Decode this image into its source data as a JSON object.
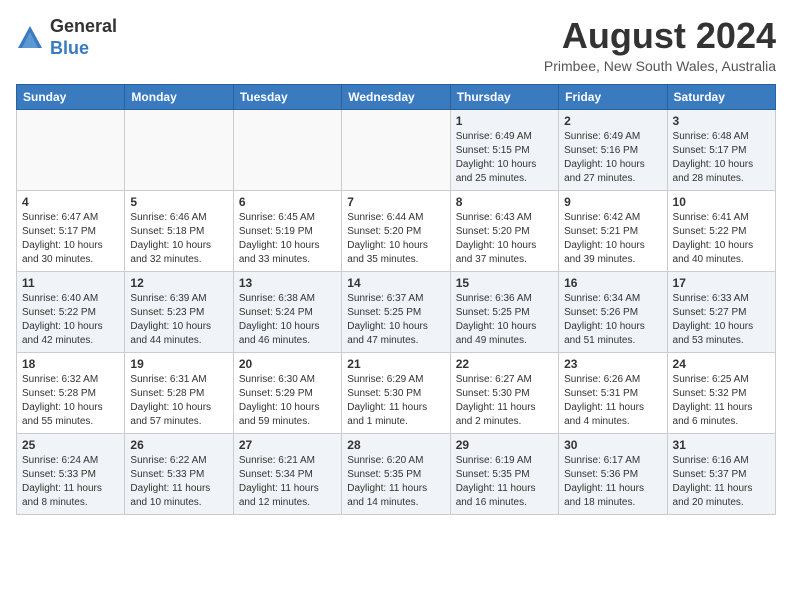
{
  "header": {
    "logo_line1": "General",
    "logo_line2": "Blue",
    "month_title": "August 2024",
    "location": "Primbee, New South Wales, Australia"
  },
  "days_of_week": [
    "Sunday",
    "Monday",
    "Tuesday",
    "Wednesday",
    "Thursday",
    "Friday",
    "Saturday"
  ],
  "weeks": [
    {
      "days": [
        {
          "date": "",
          "info": ""
        },
        {
          "date": "",
          "info": ""
        },
        {
          "date": "",
          "info": ""
        },
        {
          "date": "",
          "info": ""
        },
        {
          "date": "1",
          "info": "Sunrise: 6:49 AM\nSunset: 5:15 PM\nDaylight: 10 hours\nand 25 minutes."
        },
        {
          "date": "2",
          "info": "Sunrise: 6:49 AM\nSunset: 5:16 PM\nDaylight: 10 hours\nand 27 minutes."
        },
        {
          "date": "3",
          "info": "Sunrise: 6:48 AM\nSunset: 5:17 PM\nDaylight: 10 hours\nand 28 minutes."
        }
      ]
    },
    {
      "days": [
        {
          "date": "4",
          "info": "Sunrise: 6:47 AM\nSunset: 5:17 PM\nDaylight: 10 hours\nand 30 minutes."
        },
        {
          "date": "5",
          "info": "Sunrise: 6:46 AM\nSunset: 5:18 PM\nDaylight: 10 hours\nand 32 minutes."
        },
        {
          "date": "6",
          "info": "Sunrise: 6:45 AM\nSunset: 5:19 PM\nDaylight: 10 hours\nand 33 minutes."
        },
        {
          "date": "7",
          "info": "Sunrise: 6:44 AM\nSunset: 5:20 PM\nDaylight: 10 hours\nand 35 minutes."
        },
        {
          "date": "8",
          "info": "Sunrise: 6:43 AM\nSunset: 5:20 PM\nDaylight: 10 hours\nand 37 minutes."
        },
        {
          "date": "9",
          "info": "Sunrise: 6:42 AM\nSunset: 5:21 PM\nDaylight: 10 hours\nand 39 minutes."
        },
        {
          "date": "10",
          "info": "Sunrise: 6:41 AM\nSunset: 5:22 PM\nDaylight: 10 hours\nand 40 minutes."
        }
      ]
    },
    {
      "days": [
        {
          "date": "11",
          "info": "Sunrise: 6:40 AM\nSunset: 5:22 PM\nDaylight: 10 hours\nand 42 minutes."
        },
        {
          "date": "12",
          "info": "Sunrise: 6:39 AM\nSunset: 5:23 PM\nDaylight: 10 hours\nand 44 minutes."
        },
        {
          "date": "13",
          "info": "Sunrise: 6:38 AM\nSunset: 5:24 PM\nDaylight: 10 hours\nand 46 minutes."
        },
        {
          "date": "14",
          "info": "Sunrise: 6:37 AM\nSunset: 5:25 PM\nDaylight: 10 hours\nand 47 minutes."
        },
        {
          "date": "15",
          "info": "Sunrise: 6:36 AM\nSunset: 5:25 PM\nDaylight: 10 hours\nand 49 minutes."
        },
        {
          "date": "16",
          "info": "Sunrise: 6:34 AM\nSunset: 5:26 PM\nDaylight: 10 hours\nand 51 minutes."
        },
        {
          "date": "17",
          "info": "Sunrise: 6:33 AM\nSunset: 5:27 PM\nDaylight: 10 hours\nand 53 minutes."
        }
      ]
    },
    {
      "days": [
        {
          "date": "18",
          "info": "Sunrise: 6:32 AM\nSunset: 5:28 PM\nDaylight: 10 hours\nand 55 minutes."
        },
        {
          "date": "19",
          "info": "Sunrise: 6:31 AM\nSunset: 5:28 PM\nDaylight: 10 hours\nand 57 minutes."
        },
        {
          "date": "20",
          "info": "Sunrise: 6:30 AM\nSunset: 5:29 PM\nDaylight: 10 hours\nand 59 minutes."
        },
        {
          "date": "21",
          "info": "Sunrise: 6:29 AM\nSunset: 5:30 PM\nDaylight: 11 hours\nand 1 minute."
        },
        {
          "date": "22",
          "info": "Sunrise: 6:27 AM\nSunset: 5:30 PM\nDaylight: 11 hours\nand 2 minutes."
        },
        {
          "date": "23",
          "info": "Sunrise: 6:26 AM\nSunset: 5:31 PM\nDaylight: 11 hours\nand 4 minutes."
        },
        {
          "date": "24",
          "info": "Sunrise: 6:25 AM\nSunset: 5:32 PM\nDaylight: 11 hours\nand 6 minutes."
        }
      ]
    },
    {
      "days": [
        {
          "date": "25",
          "info": "Sunrise: 6:24 AM\nSunset: 5:33 PM\nDaylight: 11 hours\nand 8 minutes."
        },
        {
          "date": "26",
          "info": "Sunrise: 6:22 AM\nSunset: 5:33 PM\nDaylight: 11 hours\nand 10 minutes."
        },
        {
          "date": "27",
          "info": "Sunrise: 6:21 AM\nSunset: 5:34 PM\nDaylight: 11 hours\nand 12 minutes."
        },
        {
          "date": "28",
          "info": "Sunrise: 6:20 AM\nSunset: 5:35 PM\nDaylight: 11 hours\nand 14 minutes."
        },
        {
          "date": "29",
          "info": "Sunrise: 6:19 AM\nSunset: 5:35 PM\nDaylight: 11 hours\nand 16 minutes."
        },
        {
          "date": "30",
          "info": "Sunrise: 6:17 AM\nSunset: 5:36 PM\nDaylight: 11 hours\nand 18 minutes."
        },
        {
          "date": "31",
          "info": "Sunrise: 6:16 AM\nSunset: 5:37 PM\nDaylight: 11 hours\nand 20 minutes."
        }
      ]
    }
  ]
}
